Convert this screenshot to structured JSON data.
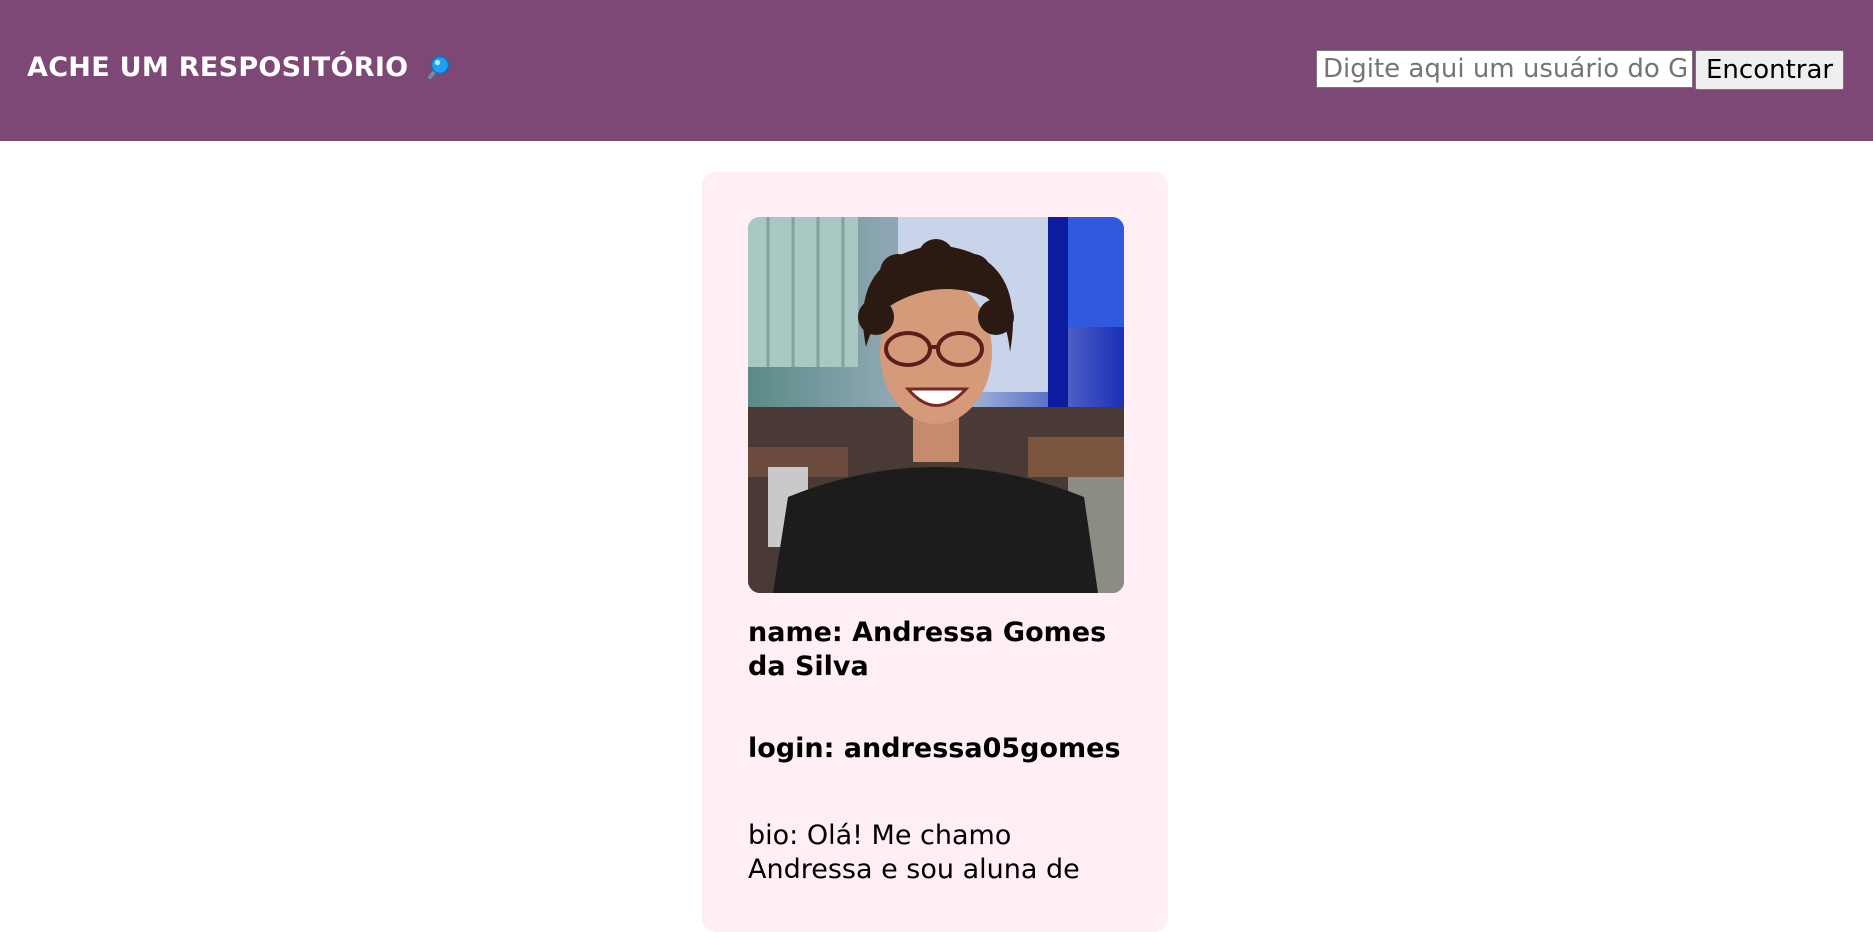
{
  "header": {
    "title": "ACHE UM RESPOSITÓRIO",
    "title_icon": "magnifying-glass-icon",
    "search": {
      "value": "",
      "placeholder": "Digite aqui um usuário do GitHub"
    },
    "search_button_label": "Encontrar"
  },
  "colors": {
    "header_bg": "#7d4875",
    "card_bg": "#ffeef4",
    "icon_blue": "#1da1f2"
  },
  "profile": {
    "avatar_icon": "profile-photo",
    "name": "name: Andressa Gomes da Silva",
    "login": "login: andressa05gomes",
    "bio": "bio: Olá! Me chamo Andressa e sou aluna de"
  }
}
